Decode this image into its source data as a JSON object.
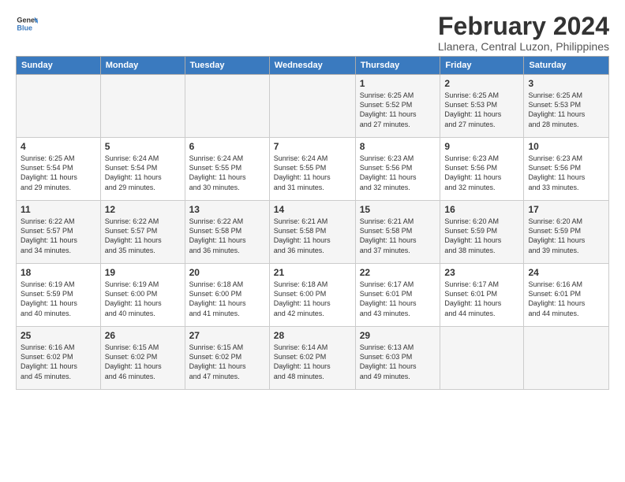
{
  "logo": {
    "line1": "General",
    "line2": "Blue"
  },
  "title": "February 2024",
  "location": "Llanera, Central Luzon, Philippines",
  "days_of_week": [
    "Sunday",
    "Monday",
    "Tuesday",
    "Wednesday",
    "Thursday",
    "Friday",
    "Saturday"
  ],
  "weeks": [
    [
      {
        "day": "",
        "info": ""
      },
      {
        "day": "",
        "info": ""
      },
      {
        "day": "",
        "info": ""
      },
      {
        "day": "",
        "info": ""
      },
      {
        "day": "1",
        "info": "Sunrise: 6:25 AM\nSunset: 5:52 PM\nDaylight: 11 hours\nand 27 minutes."
      },
      {
        "day": "2",
        "info": "Sunrise: 6:25 AM\nSunset: 5:53 PM\nDaylight: 11 hours\nand 27 minutes."
      },
      {
        "day": "3",
        "info": "Sunrise: 6:25 AM\nSunset: 5:53 PM\nDaylight: 11 hours\nand 28 minutes."
      }
    ],
    [
      {
        "day": "4",
        "info": "Sunrise: 6:25 AM\nSunset: 5:54 PM\nDaylight: 11 hours\nand 29 minutes."
      },
      {
        "day": "5",
        "info": "Sunrise: 6:24 AM\nSunset: 5:54 PM\nDaylight: 11 hours\nand 29 minutes."
      },
      {
        "day": "6",
        "info": "Sunrise: 6:24 AM\nSunset: 5:55 PM\nDaylight: 11 hours\nand 30 minutes."
      },
      {
        "day": "7",
        "info": "Sunrise: 6:24 AM\nSunset: 5:55 PM\nDaylight: 11 hours\nand 31 minutes."
      },
      {
        "day": "8",
        "info": "Sunrise: 6:23 AM\nSunset: 5:56 PM\nDaylight: 11 hours\nand 32 minutes."
      },
      {
        "day": "9",
        "info": "Sunrise: 6:23 AM\nSunset: 5:56 PM\nDaylight: 11 hours\nand 32 minutes."
      },
      {
        "day": "10",
        "info": "Sunrise: 6:23 AM\nSunset: 5:56 PM\nDaylight: 11 hours\nand 33 minutes."
      }
    ],
    [
      {
        "day": "11",
        "info": "Sunrise: 6:22 AM\nSunset: 5:57 PM\nDaylight: 11 hours\nand 34 minutes."
      },
      {
        "day": "12",
        "info": "Sunrise: 6:22 AM\nSunset: 5:57 PM\nDaylight: 11 hours\nand 35 minutes."
      },
      {
        "day": "13",
        "info": "Sunrise: 6:22 AM\nSunset: 5:58 PM\nDaylight: 11 hours\nand 36 minutes."
      },
      {
        "day": "14",
        "info": "Sunrise: 6:21 AM\nSunset: 5:58 PM\nDaylight: 11 hours\nand 36 minutes."
      },
      {
        "day": "15",
        "info": "Sunrise: 6:21 AM\nSunset: 5:58 PM\nDaylight: 11 hours\nand 37 minutes."
      },
      {
        "day": "16",
        "info": "Sunrise: 6:20 AM\nSunset: 5:59 PM\nDaylight: 11 hours\nand 38 minutes."
      },
      {
        "day": "17",
        "info": "Sunrise: 6:20 AM\nSunset: 5:59 PM\nDaylight: 11 hours\nand 39 minutes."
      }
    ],
    [
      {
        "day": "18",
        "info": "Sunrise: 6:19 AM\nSunset: 5:59 PM\nDaylight: 11 hours\nand 40 minutes."
      },
      {
        "day": "19",
        "info": "Sunrise: 6:19 AM\nSunset: 6:00 PM\nDaylight: 11 hours\nand 40 minutes."
      },
      {
        "day": "20",
        "info": "Sunrise: 6:18 AM\nSunset: 6:00 PM\nDaylight: 11 hours\nand 41 minutes."
      },
      {
        "day": "21",
        "info": "Sunrise: 6:18 AM\nSunset: 6:00 PM\nDaylight: 11 hours\nand 42 minutes."
      },
      {
        "day": "22",
        "info": "Sunrise: 6:17 AM\nSunset: 6:01 PM\nDaylight: 11 hours\nand 43 minutes."
      },
      {
        "day": "23",
        "info": "Sunrise: 6:17 AM\nSunset: 6:01 PM\nDaylight: 11 hours\nand 44 minutes."
      },
      {
        "day": "24",
        "info": "Sunrise: 6:16 AM\nSunset: 6:01 PM\nDaylight: 11 hours\nand 44 minutes."
      }
    ],
    [
      {
        "day": "25",
        "info": "Sunrise: 6:16 AM\nSunset: 6:02 PM\nDaylight: 11 hours\nand 45 minutes."
      },
      {
        "day": "26",
        "info": "Sunrise: 6:15 AM\nSunset: 6:02 PM\nDaylight: 11 hours\nand 46 minutes."
      },
      {
        "day": "27",
        "info": "Sunrise: 6:15 AM\nSunset: 6:02 PM\nDaylight: 11 hours\nand 47 minutes."
      },
      {
        "day": "28",
        "info": "Sunrise: 6:14 AM\nSunset: 6:02 PM\nDaylight: 11 hours\nand 48 minutes."
      },
      {
        "day": "29",
        "info": "Sunrise: 6:13 AM\nSunset: 6:03 PM\nDaylight: 11 hours\nand 49 minutes."
      },
      {
        "day": "",
        "info": ""
      },
      {
        "day": "",
        "info": ""
      }
    ]
  ]
}
